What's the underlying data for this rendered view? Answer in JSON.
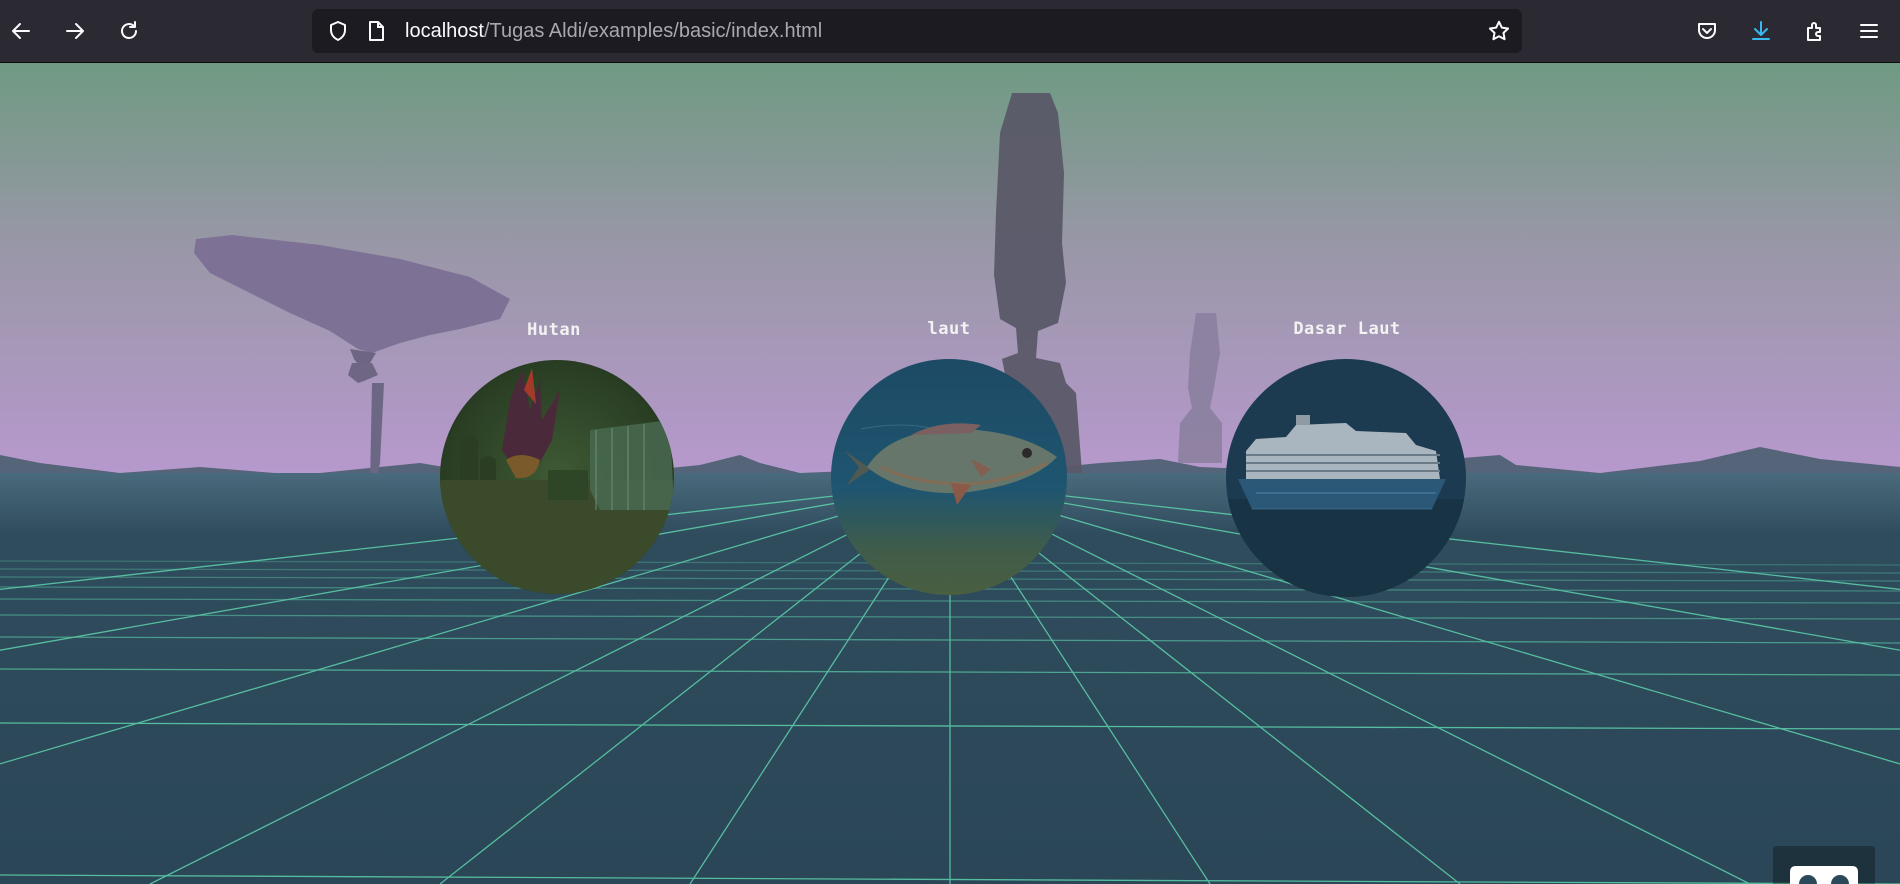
{
  "browser": {
    "url_host": "localhost",
    "url_path": "/Tugas Aldi/examples/basic/index.html",
    "icons": [
      "back-arrow-icon",
      "forward-arrow-icon",
      "reload-icon",
      "shield-icon",
      "page-icon",
      "bookmark-star-icon",
      "pocket-icon",
      "download-icon",
      "extensions-icon",
      "menu-icon"
    ]
  },
  "scene": {
    "portals": [
      {
        "label": "Hutan",
        "image": "forest-scene"
      },
      {
        "label": "laut",
        "image": "fish"
      },
      {
        "label": "Dasar Laut",
        "image": "cruise-ship"
      }
    ],
    "vr_button": "vr-headset-icon",
    "colors": {
      "sky_top": "#6f9a82",
      "sky_horizon": "#b497c9",
      "floor": "#2b4657",
      "grid": "#5fd3ad",
      "accent_download": "#38b9f0"
    }
  }
}
